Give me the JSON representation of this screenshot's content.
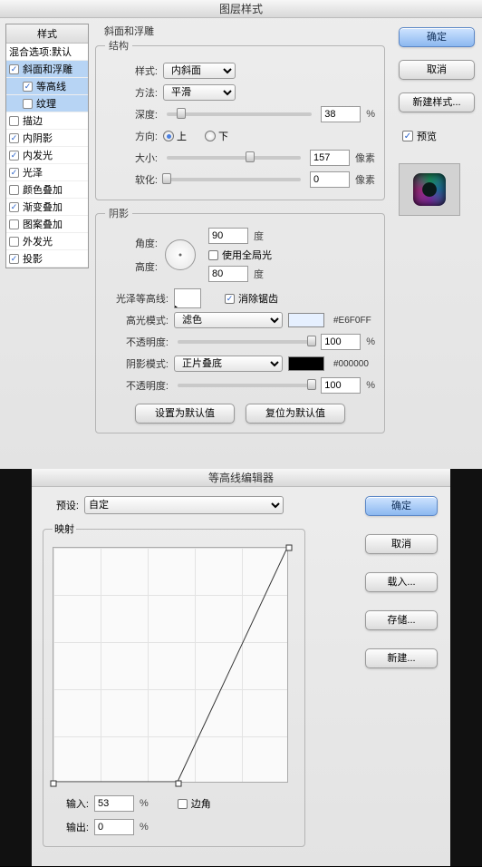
{
  "top": {
    "title": "图层样式",
    "style_header": "样式",
    "styles": [
      {
        "label": "混合选项:默认",
        "checked": false,
        "indent": false,
        "sel": false,
        "noCheckbox": true
      },
      {
        "label": "斜面和浮雕",
        "checked": true,
        "indent": false,
        "sel": true
      },
      {
        "label": "等高线",
        "checked": true,
        "indent": true,
        "sel": true
      },
      {
        "label": "纹理",
        "checked": false,
        "indent": true,
        "sel": true
      },
      {
        "label": "描边",
        "checked": false,
        "indent": false,
        "sel": false
      },
      {
        "label": "内阴影",
        "checked": true,
        "indent": false,
        "sel": false
      },
      {
        "label": "内发光",
        "checked": true,
        "indent": false,
        "sel": false
      },
      {
        "label": "光泽",
        "checked": true,
        "indent": false,
        "sel": false
      },
      {
        "label": "颜色叠加",
        "checked": false,
        "indent": false,
        "sel": false
      },
      {
        "label": "渐变叠加",
        "checked": true,
        "indent": false,
        "sel": false
      },
      {
        "label": "图案叠加",
        "checked": false,
        "indent": false,
        "sel": false
      },
      {
        "label": "外发光",
        "checked": false,
        "indent": false,
        "sel": false
      },
      {
        "label": "投影",
        "checked": true,
        "indent": false,
        "sel": false
      }
    ],
    "section_name": "斜面和浮雕",
    "structure_legend": "结构",
    "shade_legend": "阴影",
    "labels": {
      "style": "样式:",
      "method": "方法:",
      "depth": "深度:",
      "direction": "方向:",
      "size": "大小:",
      "soften": "软化:",
      "angle": "角度:",
      "altitude": "高度:",
      "deg": "度",
      "gloss_contour": "光泽等高线:",
      "antialias": "消除锯齿",
      "hl_mode": "高光模式:",
      "opacity": "不透明度:",
      "sh_mode": "阴影模式:",
      "percent": "%",
      "px": "像素",
      "up": "上",
      "down": "下",
      "global": "使用全局光"
    },
    "values": {
      "style_sel": "内斜面",
      "method_sel": "平滑",
      "depth": "38",
      "size": "157",
      "soften": "0",
      "angle": "90",
      "altitude": "80",
      "hl_mode_sel": "滤色",
      "hl_color": "#E6F0FF",
      "hl_opacity": "100",
      "sh_mode_sel": "正片叠底",
      "sh_color": "#000000",
      "sh_opacity": "100",
      "direction_up": true,
      "global": false,
      "antialias": true
    },
    "buttons": {
      "ok": "确定",
      "cancel": "取消",
      "new_style": "新建样式...",
      "preview": "预览",
      "make_default": "设置为默认值",
      "reset_default": "复位为默认值"
    }
  },
  "bottom": {
    "title": "等高线编辑器",
    "preset_label": "预设:",
    "preset_value": "自定",
    "mapping_legend": "映射",
    "input_label": "输入:",
    "output_label": "输出:",
    "corner_label": "边角",
    "input_val": "53",
    "output_val": "0",
    "percent": "%",
    "buttons": {
      "ok": "确定",
      "cancel": "取消",
      "load": "载入...",
      "save": "存储...",
      "new": "新建..."
    }
  }
}
